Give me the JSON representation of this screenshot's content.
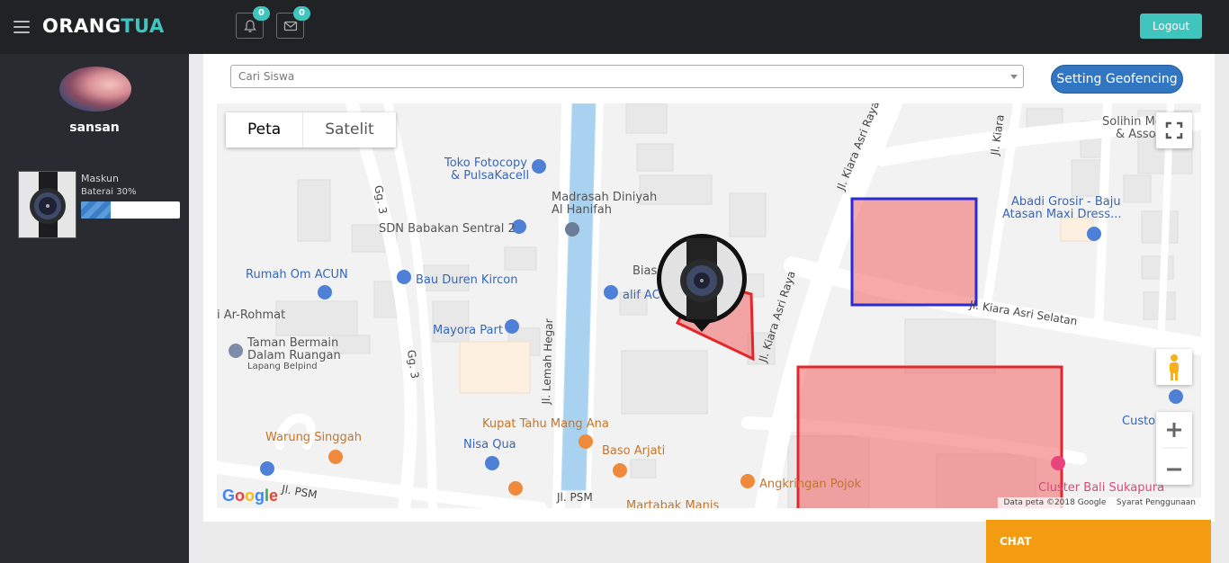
{
  "header": {
    "brand_part1": "ORANG",
    "brand_part2": "TUA",
    "notifications_count": "0",
    "messages_count": "0",
    "logout_label": "Logout",
    "accent_color": "#3fc5bd"
  },
  "sidebar": {
    "username": "sansan",
    "students": [
      {
        "name": "Maskun",
        "battery_label": "Baterai 30%",
        "battery_percent": 30
      }
    ]
  },
  "main": {
    "search_placeholder": "Cari Siswa",
    "geofencing_button": "Setting Geofencing"
  },
  "map": {
    "type_buttons": [
      "Peta",
      "Satelit"
    ],
    "active_type": "Peta",
    "labels": {
      "toko": "Toko Fotocopy",
      "toko2": "& PulsaKacell",
      "madrasah": "Madrasah Diniyah",
      "madrasah2": "Al Hanifah",
      "sdn": "SDN Babakan Sentral 2",
      "rumah": "Rumah Om ACUN",
      "bau": "Bau Duren Kircon",
      "alif": "alif AC",
      "bias": "Bias",
      "rohmat": "i Ar-Rohmat",
      "mayora": "Mayora Part",
      "taman1": "Taman Bermain",
      "taman2": "Dalam Ruangan",
      "lapang": "Lapang Belpind",
      "kupat": "Kupat Tahu Mang Ana",
      "nisa": "Nisa Qua",
      "baso": "Baso Arjati",
      "warung": "Warung Singgah",
      "angkringan": "Angkringan Pojok",
      "martabak": "Martabak Manis",
      "solihin1": "Solihin Mo",
      "solihin2": "& Asso",
      "abadi1": "Abadi Grosir - Baju",
      "abadi2": "Atasan Maxi Dress...",
      "custom": "Custom",
      "cluster": "Cluster Bali Sukapura"
    },
    "roads": {
      "gg3a": "Gg. 3",
      "gg3b": "Gg. 3",
      "lemah": "Jl. Lemah Hegar",
      "kiara1": "Jl. Kiara Asri Raya",
      "kiara2": "Jl. Kiara Asri Raya",
      "kiara3": "Jl. Kiara",
      "kiara_selatan": "Jl. Kiara Asri Selatan",
      "psm1": "Jl. PSM",
      "psm2": "Jl. PSM"
    },
    "attribution": "Data peta ©2018 Google",
    "terms": "Syarat Penggunaan",
    "google_logo": "Google"
  },
  "chat": {
    "label": "CHAT"
  },
  "colors": {
    "topbar": "#212226",
    "sidebar": "#2a2b31",
    "geofence_blue": "#2b2bd6",
    "geofence_red": "#e0272c",
    "chat": "#f39c12"
  }
}
